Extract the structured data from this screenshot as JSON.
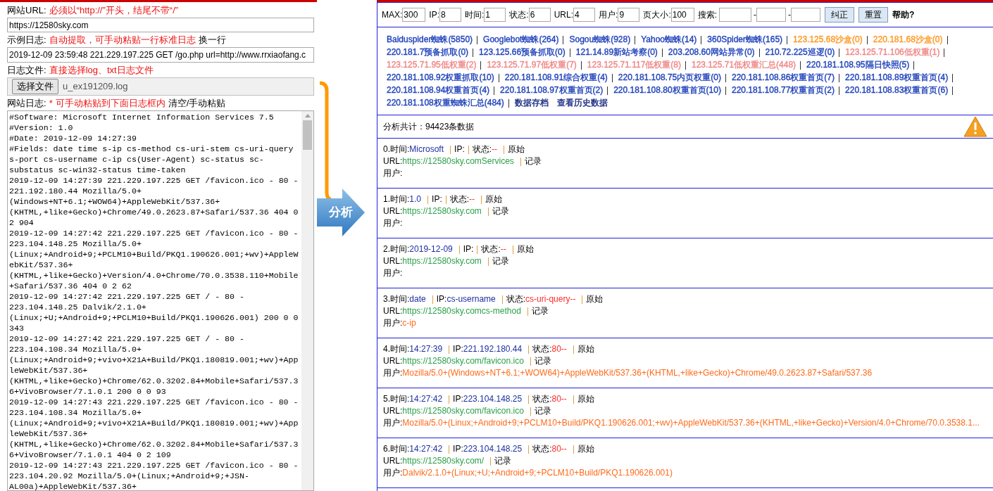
{
  "url_field": {
    "label": "网站URL:",
    "hint": "必须以“http://”开头，结尾不带“/”",
    "value": "https://12580sky.com"
  },
  "sample_log": {
    "label": "示例日志:",
    "hint": "自动提取，可手动粘贴一行标准日志",
    "action": "换一行",
    "value": "2019-12-09 23:59:48 221.229.197.225 GET /go.php url=http://www.rrxiaofang.c"
  },
  "log_file": {
    "label": "日志文件:",
    "hint": "直接选择log、txt日志文件",
    "button": "选择文件",
    "file_name": "u_ex191209.log"
  },
  "log_input": {
    "label": "网站日志:",
    "required_mark": "*",
    "hint": "可手动粘贴到下面日志框内",
    "action": "清空/手动粘贴",
    "lines": [
      "#Software: Microsoft Internet Information Services 7.5",
      "#Version: 1.0",
      "#Date: 2019-12-09 14:27:39",
      "#Fields: date time s-ip cs-method cs-uri-stem cs-uri-query",
      "s-port cs-username c-ip cs(User-Agent) sc-status sc-",
      "substatus sc-win32-status time-taken",
      "2019-12-09 14:27:39 221.229.197.225 GET /favicon.ico - 80 -",
      "221.192.180.44 Mozilla/5.0+",
      "(Windows+NT+6.1;+WOW64)+AppleWebKit/537.36+",
      "(KHTML,+like+Gecko)+Chrome/49.0.2623.87+Safari/537.36 404 0",
      "2 904",
      "2019-12-09 14:27:42 221.229.197.225 GET /favicon.ico - 80 -",
      "223.104.148.25 Mozilla/5.0+",
      "(Linux;+Android+9;+PCLM10+Build/PKQ1.190626.001;+wv)+AppleW",
      "ebKit/537.36+",
      "(KHTML,+like+Gecko)+Version/4.0+Chrome/70.0.3538.110+Mobile",
      "+Safari/537.36 404 0 2 62",
      "2019-12-09 14:27:42 221.229.197.225 GET / - 80 -",
      "223.104.148.25 Dalvik/2.1.0+",
      "(Linux;+U;+Android+9;+PCLM10+Build/PKQ1.190626.001) 200 0 0",
      "343",
      "2019-12-09 14:27:42 221.229.197.225 GET / - 80 -",
      "223.104.108.34 Mozilla/5.0+",
      "(Linux;+Android+9;+vivo+X21A+Build/PKQ1.180819.001;+wv)+App",
      "leWebKit/537.36+",
      "(KHTML,+like+Gecko)+Chrome/62.0.3202.84+Mobile+Safari/537.3",
      "6+VivoBrowser/7.1.0.1 200 0 0 93",
      "2019-12-09 14:27:43 221.229.197.225 GET /favicon.ico - 80 -",
      "223.104.108.34 Mozilla/5.0+",
      "(Linux;+Android+9;+vivo+X21A+Build/PKQ1.180819.001;+wv)+App",
      "leWebKit/537.36+",
      "(KHTML,+like+Gecko)+Chrome/62.0.3202.84+Mobile+Safari/537.3",
      "6+VivoBrowser/7.1.0.1 404 0 2 109",
      "2019-12-09 14:27:43 221.229.197.225 GET /favicon.ico - 80 -",
      "223.104.20.92 Mozilla/5.0+(Linux;+Android+9;+JSN-",
      "AL00a)+AppleWebKit/537.36+"
    ]
  },
  "analyze_button": "分析",
  "settings": [
    {
      "label": "MAX:",
      "value": "300"
    },
    {
      "label": "IP:",
      "value": "8"
    },
    {
      "label": "时间:",
      "value": "1"
    },
    {
      "label": "状态:",
      "value": "6"
    },
    {
      "label": "URL:",
      "value": "4"
    },
    {
      "label": "用户:",
      "value": "9"
    },
    {
      "label": "页大小:",
      "value": "100"
    }
  ],
  "search": {
    "label": "搜索:",
    "separators": [
      "-",
      "-"
    ]
  },
  "buttons": [
    "纠正",
    "重置"
  ],
  "help": "帮助?",
  "spider_links": [
    {
      "text": "Baiduspider蜘蛛(5850)",
      "color": "#2244bb",
      "separator": true
    },
    {
      "text": "Googlebot蜘蛛(264)",
      "color": "#2244bb",
      "separator": true
    },
    {
      "text": "Sogou蜘蛛(928)",
      "color": "#2244bb",
      "separator": true
    },
    {
      "text": "Yahoo蜘蛛(14)",
      "color": "#2244bb",
      "separator": true
    },
    {
      "text": "360Spider蜘蛛(165)",
      "color": "#2244bb",
      "separator": true
    },
    {
      "text": "123.125.68沙盒(0)",
      "color": "#ff9922",
      "separator": true
    },
    {
      "text": "220.181.68沙盒(0)",
      "color": "#ff9922",
      "separator": true
    },
    {
      "text": "220.181.7预备抓取(0)",
      "color": "#2244bb",
      "separator": true
    },
    {
      "text": "123.125.66预备抓取(0)",
      "color": "#2244bb",
      "separator": true
    },
    {
      "text": "121.14.89新站考察(0)",
      "color": "#2244bb",
      "separator": true
    },
    {
      "text": "203.208.60网站异常(0)",
      "color": "#2244bb",
      "separator": true
    },
    {
      "text": "210.72.225巡逻(0)",
      "color": "#2244bb",
      "separator": true
    },
    {
      "text": "123.125.71.106低权重(1)",
      "color": "#f08888",
      "separator": true
    },
    {
      "text": "123.125.71.95低权重(2)",
      "color": "#f08888",
      "separator": true
    },
    {
      "text": "123.125.71.97低权重(7)",
      "color": "#f08888",
      "separator": true
    },
    {
      "text": "123.125.71.117低权重(8)",
      "color": "#f08888",
      "separator": true
    },
    {
      "text": "123.125.71低权重汇总(448)",
      "color": "#f08888",
      "separator": true
    },
    {
      "text": "220.181.108.95隔日快照(5)",
      "color": "#2244bb",
      "separator": true
    },
    {
      "text": "220.181.108.92权重抓取(10)",
      "color": "#2244bb",
      "separator": true
    },
    {
      "text": "220.181.108.91综合权重(4)",
      "color": "#2244bb",
      "separator": true
    },
    {
      "text": "220.181.108.75内页权重(0)",
      "color": "#2244bb",
      "separator": true
    },
    {
      "text": "220.181.108.86权重首页(7)",
      "color": "#2244bb",
      "separator": true
    },
    {
      "text": "220.181.108.89权重首页(4)",
      "color": "#2244bb",
      "separator": true
    },
    {
      "text": "220.181.108.94权重首页(4)",
      "color": "#2244bb",
      "separator": true
    },
    {
      "text": "220.181.108.97权重首页(2)",
      "color": "#2244bb",
      "separator": true
    },
    {
      "text": "220.181.108.80权重首页(10)",
      "color": "#2244bb",
      "separator": true
    },
    {
      "text": "220.181.108.77权重首页(2)",
      "color": "#2244bb",
      "separator": true
    },
    {
      "text": "220.181.108.83权重首页(6)",
      "color": "#2244bb",
      "separator": true
    },
    {
      "text": "220.181.108权重蜘蛛汇总(484)",
      "color": "#2244bb",
      "separator": true
    },
    {
      "text": "数据存档",
      "color": "#1a2a80",
      "separator": false
    },
    {
      "text": "查看历史数据",
      "color": "#1a2a80",
      "separator": false
    }
  ],
  "summary": "分析共计：94423条数据",
  "records": [
    {
      "index": "0.",
      "time_label": "时间:",
      "time": "Microsoft",
      "ip_label": "IP:",
      "status_label": "状态:",
      "status": "--",
      "raw_link": "原始",
      "url_label": "URL:",
      "url": "https://12580sky.comServices",
      "log_link": "记录",
      "user_label": "用户:"
    },
    {
      "index": "1.",
      "time_label": "时间:",
      "time": "1.0",
      "ip_label": "IP:",
      "status_label": "状态:",
      "status": "--",
      "raw_link": "原始",
      "url_label": "URL:",
      "url": "https://12580sky.com",
      "log_link": "记录",
      "user_label": "用户:"
    },
    {
      "index": "2.",
      "time_label": "时间:",
      "time": "2019-12-09",
      "ip_label": "IP:",
      "status_label": "状态:",
      "status": "--",
      "raw_link": "原始",
      "url_label": "URL:",
      "url": "https://12580sky.com",
      "log_link": "记录",
      "user_label": "用户:"
    },
    {
      "index": "3.",
      "time_label": "时间:",
      "time": "date",
      "ip_label": "IP:",
      "ip": "cs-username",
      "status_label": "状态:",
      "status": "cs-uri-query--",
      "raw_link": "原始",
      "url_label": "URL:",
      "url": "https://12580sky.comcs-method",
      "log_link": "记录",
      "user_label": "用户:",
      "user": "c-ip"
    },
    {
      "index": "4.",
      "time_label": "时间:",
      "time": "14:27:39",
      "ip_label": "IP:",
      "ip": "221.192.180.44",
      "status_label": "状态:",
      "status": "80--",
      "raw_link": "原始",
      "url_label": "URL:",
      "url": "https://12580sky.com/favicon.ico",
      "log_link": "记录",
      "user_label": "用户:",
      "user": "Mozilla/5.0+(Windows+NT+6.1;+WOW64)+AppleWebKit/537.36+(KHTML,+like+Gecko)+Chrome/49.0.2623.87+Safari/537.36"
    },
    {
      "index": "5.",
      "time_label": "时间:",
      "time": "14:27:42",
      "ip_label": "IP:",
      "ip": "223.104.148.25",
      "status_label": "状态:",
      "status": "80--",
      "raw_link": "原始",
      "url_label": "URL:",
      "url": "https://12580sky.com/favicon.ico",
      "log_link": "记录",
      "user_label": "用户:",
      "user": "Mozilla/5.0+(Linux;+Android+9;+PCLM10+Build/PKQ1.190626.001;+wv)+AppleWebKit/537.36+(KHTML,+like+Gecko)+Version/4.0+Chrome/70.0.3538.1..."
    },
    {
      "index": "6.",
      "time_label": "时间:",
      "time": "14:27:42",
      "ip_label": "IP:",
      "ip": "223.104.148.25",
      "status_label": "状态:",
      "status": "80--",
      "raw_link": "原始",
      "url_label": "URL:",
      "url": "https://12580sky.com/",
      "log_link": "记录",
      "user_label": "用户:",
      "user": "Dalvik/2.1.0+(Linux;+U;+Android+9;+PCLM10+Build/PKQ1.190626.001)"
    }
  ]
}
